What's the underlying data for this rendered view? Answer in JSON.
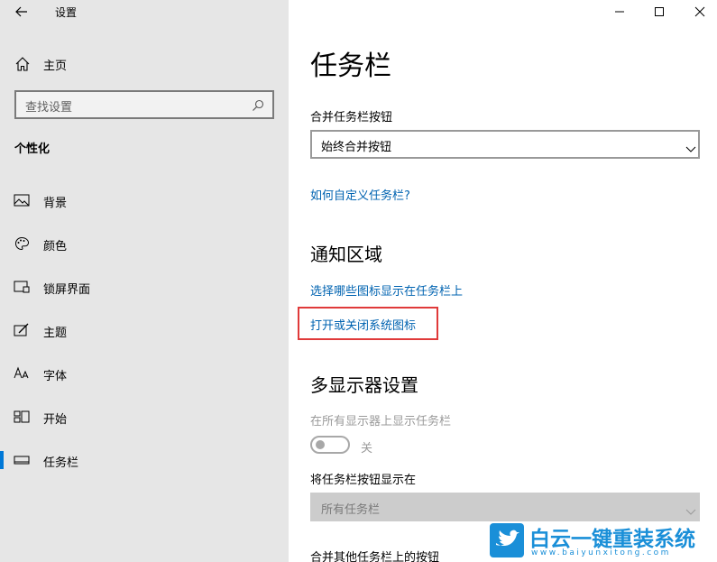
{
  "app": {
    "title": "设置"
  },
  "sidebar": {
    "home": "主页",
    "search_placeholder": "查找设置",
    "section": "个性化",
    "items": [
      {
        "label": "背景",
        "icon": "image-icon"
      },
      {
        "label": "颜色",
        "icon": "palette-icon"
      },
      {
        "label": "锁屏界面",
        "icon": "lock-screen-icon"
      },
      {
        "label": "主题",
        "icon": "theme-icon"
      },
      {
        "label": "字体",
        "icon": "font-icon"
      },
      {
        "label": "开始",
        "icon": "start-icon"
      },
      {
        "label": "任务栏",
        "icon": "taskbar-icon",
        "active": true
      }
    ]
  },
  "main": {
    "title": "任务栏",
    "combine_label": "合并任务栏按钮",
    "combine_value": "始终合并按钮",
    "customize_link": "如何自定义任务栏?",
    "notify_heading": "通知区域",
    "notify_link1": "选择哪些图标显示在任务栏上",
    "notify_link2": "打开或关闭系统图标",
    "multi_heading": "多显示器设置",
    "multi_show_label": "在所有显示器上显示任务栏",
    "toggle_state": "关",
    "show_buttons_label": "将任务栏按钮显示在",
    "show_buttons_value": "所有任务栏",
    "combine_other_label": "合并其他任务栏上的按钮"
  },
  "watermark": {
    "name": "白云一键重装系统",
    "url": "www.baiyunxitong.com"
  },
  "colors": {
    "accent": "#0078d7",
    "link": "#0063b1",
    "highlight": "#e03a3a",
    "sidebar": "#e6e6e6"
  }
}
